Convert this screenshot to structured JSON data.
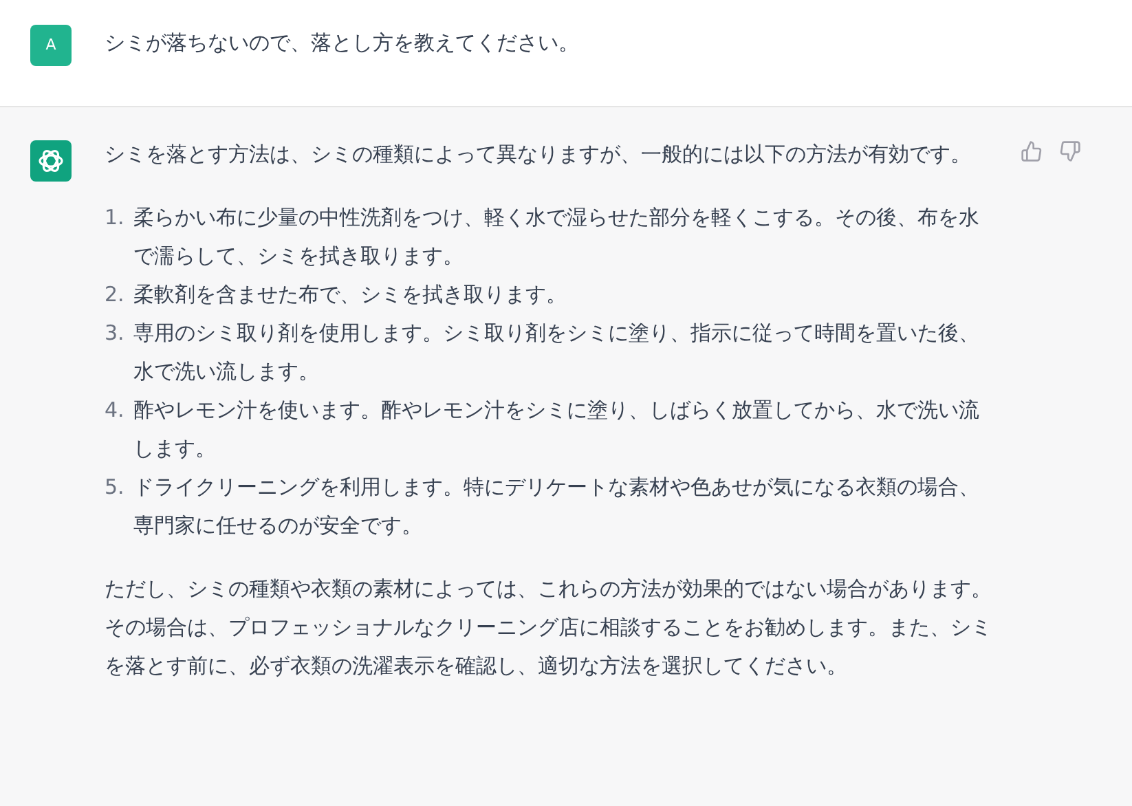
{
  "user_message": {
    "avatar": "A",
    "text": "シミが落ちないので、落とし方を教えてください。"
  },
  "assistant_message": {
    "intro": "シミを落とす方法は、シミの種類によって異なりますが、一般的には以下の方法が有効です。",
    "steps": [
      {
        "number": "1.",
        "text": "柔らかい布に少量の中性洗剤をつけ、軽く水で湿らせた部分を軽くこする。その後、布を水で濡らして、シミを拭き取ります。"
      },
      {
        "number": "2.",
        "text": "柔軟剤を含ませた布で、シミを拭き取ります。"
      },
      {
        "number": "3.",
        "text": "専用のシミ取り剤を使用します。シミ取り剤をシミに塗り、指示に従って時間を置いた後、水で洗い流します。"
      },
      {
        "number": "4.",
        "text": "酢やレモン汁を使います。酢やレモン汁をシミに塗り、しばらく放置してから、水で洗い流します。"
      },
      {
        "number": "5.",
        "text": "ドライクリーニングを利用します。特にデリケートな素材や色あせが気になる衣類の場合、専門家に任せるのが安全です。"
      }
    ],
    "conclusion": "ただし、シミの種類や衣類の素材によっては、これらの方法が効果的ではない場合があります。その場合は、プロフェッショナルなクリーニング店に相談することをお勧めします。また、シミを落とす前に、必ず衣類の洗濯表示を確認し、適切な方法を選択してください。"
  }
}
